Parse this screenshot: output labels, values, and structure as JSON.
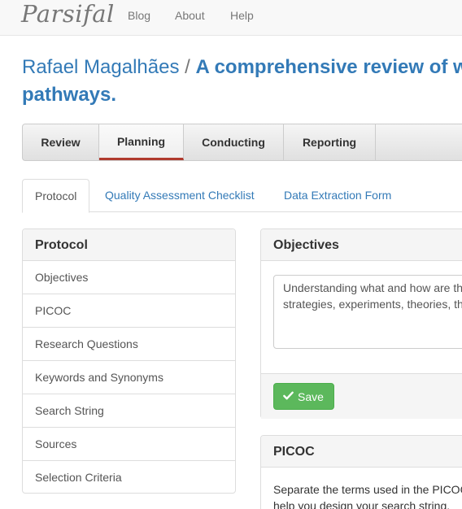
{
  "navbar": {
    "brand": "Parsifal",
    "links": [
      "Blog",
      "About",
      "Help"
    ]
  },
  "title": {
    "author": "Rafael Magalhães",
    "separator": "/",
    "review_line1": "A comprehensive review of we",
    "review_line2": "pathways."
  },
  "main_tabs": [
    {
      "label": "Review",
      "active": false
    },
    {
      "label": "Planning",
      "active": true
    },
    {
      "label": "Conducting",
      "active": false
    },
    {
      "label": "Reporting",
      "active": false
    }
  ],
  "sub_tabs": [
    {
      "label": "Protocol",
      "active": true
    },
    {
      "label": "Quality Assessment Checklist",
      "active": false
    },
    {
      "label": "Data Extraction Form",
      "active": false
    }
  ],
  "sidebar": {
    "heading": "Protocol",
    "items": [
      "Objectives",
      "PICOC",
      "Research Questions",
      "Keywords and Synonyms",
      "Search String",
      "Sources",
      "Selection Criteria"
    ]
  },
  "objectives": {
    "heading": "Objectives",
    "text_line1": "Understanding what and how are th",
    "text_line2": "strategies, experiments, theories, th",
    "save_label": "Save"
  },
  "picoc": {
    "heading": "PICOC",
    "text_line1": "Separate the terms used in the PICOC",
    "text_line2": "help you design your search string."
  },
  "colors": {
    "link": "#337ab7",
    "active_tab_underline": "#b03a2e",
    "save_button": "#5cb85c"
  }
}
